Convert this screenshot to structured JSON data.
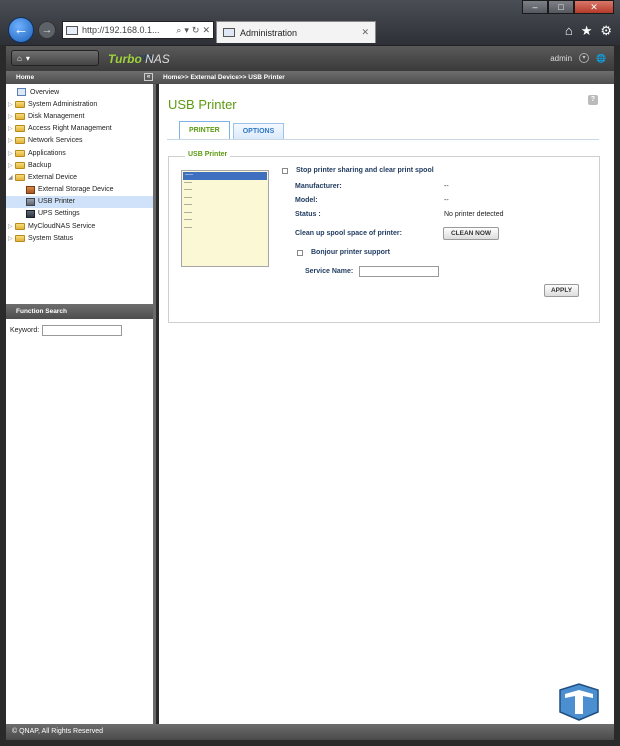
{
  "browser": {
    "url": "http://192.168.0.1...",
    "tab_title": "Administration",
    "min": "–",
    "max": "□",
    "close": "✕"
  },
  "header": {
    "nas_label": "NAS",
    "brand_a": "Turbo",
    "brand_b": "NAS",
    "user": "admin"
  },
  "subbar": {
    "home": "Home",
    "breadcrumb": "Home>> External Device>> USB Printer"
  },
  "sidebar": {
    "items": [
      {
        "label": "Overview"
      },
      {
        "label": "System Administration"
      },
      {
        "label": "Disk Management"
      },
      {
        "label": "Access Right Management"
      },
      {
        "label": "Network Services"
      },
      {
        "label": "Applications"
      },
      {
        "label": "Backup"
      },
      {
        "label": "External Device"
      },
      {
        "label": "External Storage Device"
      },
      {
        "label": "USB Printer"
      },
      {
        "label": "UPS Settings"
      },
      {
        "label": "MyCloudNAS Service"
      },
      {
        "label": "System Status"
      }
    ],
    "function_search_title": "Function Search",
    "keyword_label": "Keyword:"
  },
  "main": {
    "title": "USB Printer",
    "help": "?",
    "tabs": [
      {
        "label": "PRINTER"
      },
      {
        "label": "OPTIONS"
      }
    ],
    "legend": "USB Printer",
    "printer_list": [
      "----",
      "----",
      "----",
      "----",
      "----",
      "----",
      "----",
      "----"
    ],
    "stop_sharing_label": "Stop printer sharing and clear print spool",
    "manufacturer_label": "Manufacturer:",
    "manufacturer_value": "--",
    "model_label": "Model:",
    "model_value": "--",
    "status_label": "Status :",
    "status_value": "No printer detected",
    "cleanup_label": "Clean up spool space of printer:",
    "clean_now_button": "CLEAN NOW",
    "bonjour_label": "Bonjour printer support",
    "service_name_label": "Service Name:",
    "apply_button": "APPLY"
  },
  "footer": {
    "copyright": "© QNAP, All Rights Reserved"
  },
  "colors": {
    "accent_green": "#5c9a12",
    "tab_blue": "#2f77c6",
    "label_navy": "#1f3a5f"
  }
}
